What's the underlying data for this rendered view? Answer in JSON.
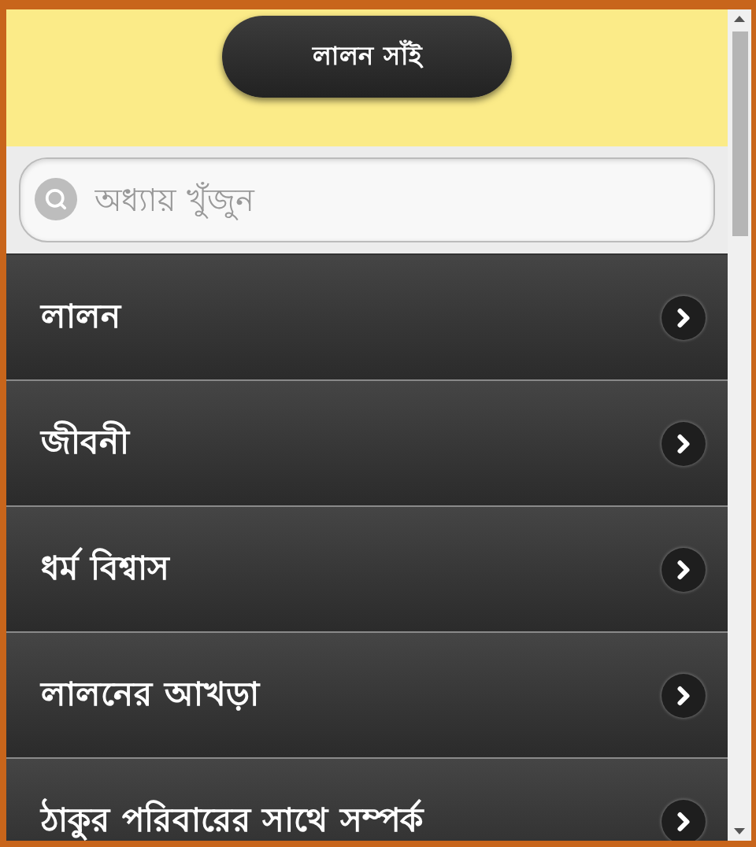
{
  "header": {
    "title": "লালন সাঁই"
  },
  "search": {
    "placeholder": "অধ্যায় খুঁজুন"
  },
  "items": [
    {
      "label": "লালন"
    },
    {
      "label": "জীবনী"
    },
    {
      "label": "ধর্ম বিশ্বাস"
    },
    {
      "label": "লালনের আখড়া"
    },
    {
      "label": "ঠাকুর পরিবারের সাথে সম্পর্ক"
    }
  ]
}
